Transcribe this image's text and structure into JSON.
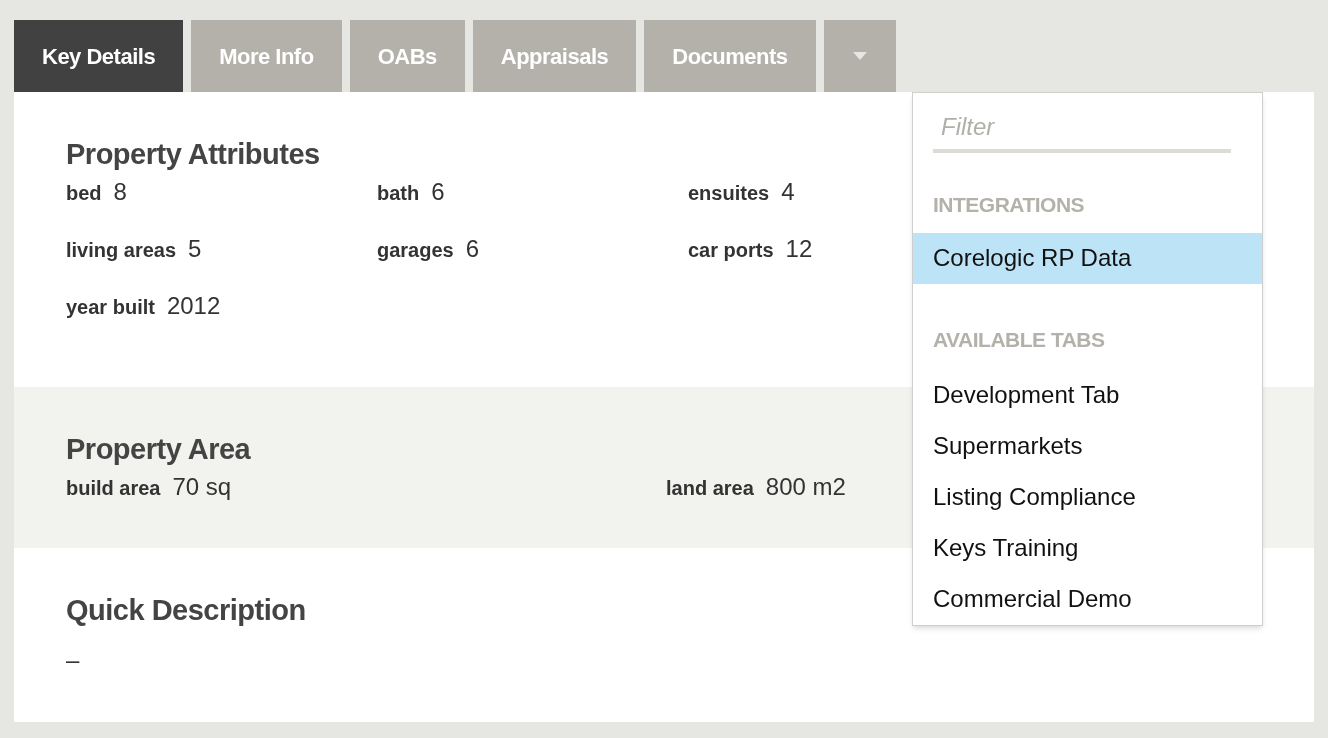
{
  "tabs": [
    {
      "label": "Key Details",
      "selected": true
    },
    {
      "label": "More Info",
      "selected": false
    },
    {
      "label": "OABs",
      "selected": false
    },
    {
      "label": "Appraisals",
      "selected": false
    },
    {
      "label": "Documents",
      "selected": false
    }
  ],
  "sections": [
    {
      "kind": "three-column",
      "shaded": false,
      "title": "Property Attributes",
      "fields": [
        {
          "label": "bed",
          "value": "8"
        },
        {
          "label": "bath",
          "value": "6"
        },
        {
          "label": "ensuites",
          "value": "4"
        },
        {
          "label": "living areas",
          "value": "5"
        },
        {
          "label": "garages",
          "value": "6"
        },
        {
          "label": "car ports",
          "value": "12"
        },
        {
          "label": "year built",
          "value": "2012"
        }
      ]
    },
    {
      "kind": "two-column",
      "shaded": true,
      "title": "Property Area",
      "fields": [
        {
          "label": "build area",
          "value": "70 sq"
        },
        {
          "label": "land area",
          "value": "800 m2"
        }
      ]
    },
    {
      "kind": "text",
      "shaded": false,
      "title": "Quick Description",
      "text": "–"
    }
  ],
  "dropdown": {
    "placeholder": "Filter",
    "groups": [
      {
        "heading": "INTEGRATIONS",
        "items": [
          {
            "label": "Corelogic RP Data",
            "selected": true
          }
        ]
      },
      {
        "heading": "AVAILABLE TABS",
        "items": [
          {
            "label": "Development Tab",
            "selected": false
          },
          {
            "label": "Supermarkets",
            "selected": false
          },
          {
            "label": "Listing Compliance",
            "selected": false
          },
          {
            "label": "Keys Training",
            "selected": false
          },
          {
            "label": "Commercial Demo",
            "selected": false
          }
        ]
      }
    ]
  }
}
